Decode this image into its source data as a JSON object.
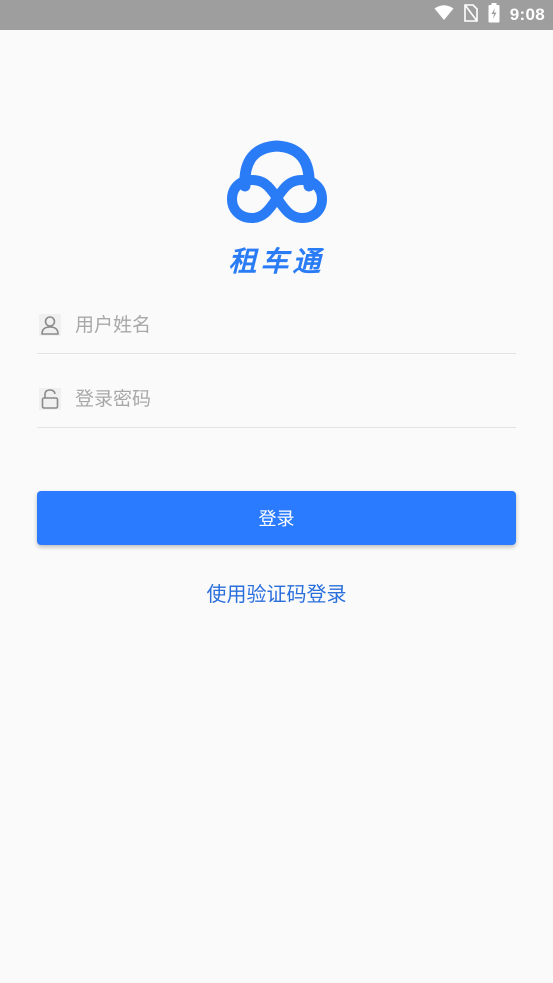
{
  "status_bar": {
    "time": "9:08",
    "icons": [
      "wifi-icon",
      "no-sim-icon",
      "battery-charging-icon"
    ]
  },
  "brand": {
    "name": "租车通",
    "logo_icon": "cloud-infinity-logo",
    "color": "#2a7bf6"
  },
  "form": {
    "username_placeholder": "用户姓名",
    "username_value": "",
    "password_placeholder": "登录密码",
    "password_value": "",
    "login_button": "登录",
    "code_login_link": "使用验证码登录"
  },
  "colors": {
    "primary": "#2a7bff",
    "link": "#2a6fdc",
    "background": "#fafafa",
    "status_bar": "#9e9e9e"
  }
}
